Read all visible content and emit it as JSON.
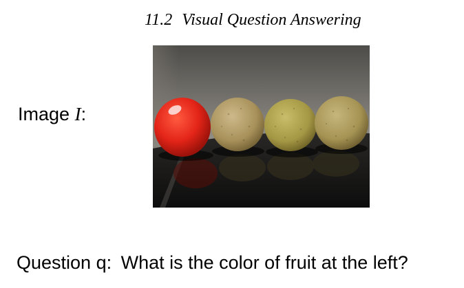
{
  "header": {
    "section_number": "11.2",
    "section_title": "Visual Question Answering"
  },
  "image_label": {
    "prefix": "Image",
    "variable": "I",
    "suffix": ":"
  },
  "question": {
    "prefix": "Question q:",
    "text": "What is the color of fruit at the left?"
  },
  "photo": {
    "content": [
      {
        "fruit": "tomato",
        "color": "#e32418"
      },
      {
        "fruit": "longan",
        "color": "#a8915a"
      },
      {
        "fruit": "longan",
        "color": "#a59845"
      },
      {
        "fruit": "longan",
        "color": "#a59353"
      }
    ]
  }
}
